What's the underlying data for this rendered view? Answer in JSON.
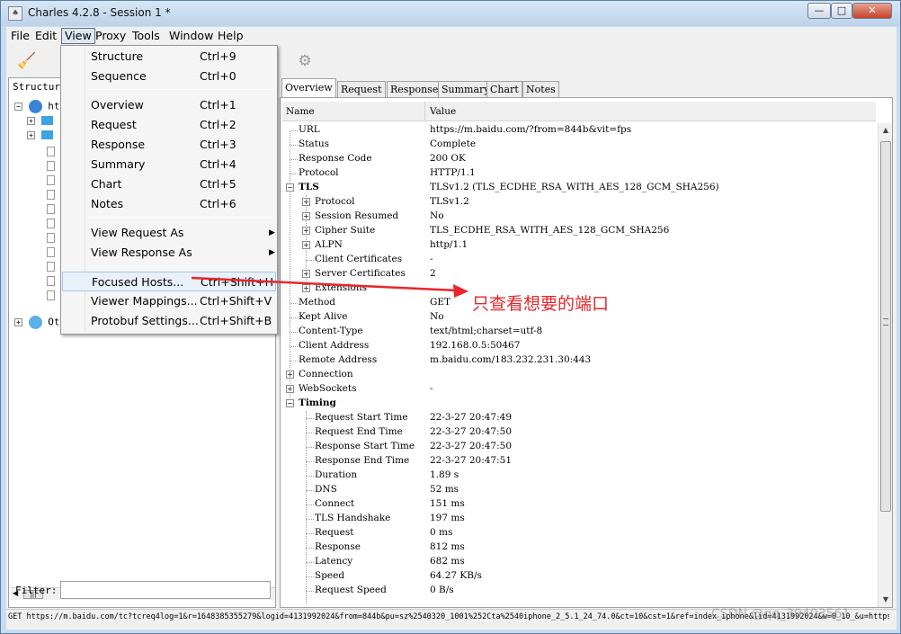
{
  "window": {
    "title": "Charles 4.2.8 - Session 1 *",
    "app_icon": "charles-icon",
    "controls": {
      "minimize": "—",
      "maximize": "□",
      "close": "✕"
    }
  },
  "menubar": {
    "items": [
      "File",
      "Edit",
      "View",
      "Proxy",
      "Tools",
      "Window",
      "Help"
    ],
    "active": "View"
  },
  "toolbar": {
    "icons": [
      "broom-icon",
      "gear-icon"
    ]
  },
  "view_menu": {
    "items": [
      {
        "label": "Structure",
        "shortcut": "Ctrl+9"
      },
      {
        "label": "Sequence",
        "shortcut": "Ctrl+0"
      },
      {
        "label": "Overview",
        "shortcut": "Ctrl+1"
      },
      {
        "label": "Request",
        "shortcut": "Ctrl+2"
      },
      {
        "label": "Response",
        "shortcut": "Ctrl+3"
      },
      {
        "label": "Summary",
        "shortcut": "Ctrl+4"
      },
      {
        "label": "Chart",
        "shortcut": "Ctrl+5"
      },
      {
        "label": "Notes",
        "shortcut": "Ctrl+6"
      },
      {
        "label": "View Request As",
        "submenu": true
      },
      {
        "label": "View Response As",
        "submenu": true
      },
      {
        "label": "Focused Hosts...",
        "shortcut": "Ctrl+Shift+H",
        "highlighted": true
      },
      {
        "label": "Viewer Mappings...",
        "shortcut": "Ctrl+Shift+V"
      },
      {
        "label": "Protobuf Settings...",
        "shortcut": "Ctrl+Shift+B"
      }
    ]
  },
  "left_panel": {
    "tab": "Structure",
    "tree": {
      "root_label": "htt",
      "other_label": "Oth"
    },
    "filter_label": "Filter:",
    "filter_value": ""
  },
  "right_panel": {
    "tabs": [
      "Overview",
      "Request",
      "Response",
      "Summary",
      "Chart",
      "Notes"
    ],
    "active_tab": "Overview",
    "columns": {
      "name": "Name",
      "value": "Value"
    },
    "rows": [
      {
        "name": "URL",
        "value": "https://m.baidu.com/?from=844b&vit=fps"
      },
      {
        "name": "Status",
        "value": "Complete"
      },
      {
        "name": "Response Code",
        "value": "200 OK"
      },
      {
        "name": "Protocol",
        "value": "HTTP/1.1"
      },
      {
        "name": "TLS",
        "value": "TLSv1.2 (TLS_ECDHE_RSA_WITH_AES_128_GCM_SHA256)"
      },
      {
        "name": "Protocol",
        "value": "TLSv1.2"
      },
      {
        "name": "Session Resumed",
        "value": "No"
      },
      {
        "name": "Cipher Suite",
        "value": "TLS_ECDHE_RSA_WITH_AES_128_GCM_SHA256"
      },
      {
        "name": "ALPN",
        "value": "http/1.1"
      },
      {
        "name": "Client Certificates",
        "value": "-"
      },
      {
        "name": "Server Certificates",
        "value": "2"
      },
      {
        "name": "Extensions",
        "value": ""
      },
      {
        "name": "Method",
        "value": "GET"
      },
      {
        "name": "Kept Alive",
        "value": "No"
      },
      {
        "name": "Content-Type",
        "value": "text/html;charset=utf-8"
      },
      {
        "name": "Client Address",
        "value": "192.168.0.5:50467"
      },
      {
        "name": "Remote Address",
        "value": "m.baidu.com/183.232.231.30:443"
      },
      {
        "name": "Connection",
        "value": ""
      },
      {
        "name": "WebSockets",
        "value": "-"
      },
      {
        "name": "Timing",
        "value": ""
      },
      {
        "name": "Request Start Time",
        "value": "22-3-27 20:47:49"
      },
      {
        "name": "Request End Time",
        "value": "22-3-27 20:47:50"
      },
      {
        "name": "Response Start Time",
        "value": "22-3-27 20:47:50"
      },
      {
        "name": "Response End Time",
        "value": "22-3-27 20:47:51"
      },
      {
        "name": "Duration",
        "value": "1.89 s"
      },
      {
        "name": "DNS",
        "value": "52 ms"
      },
      {
        "name": "Connect",
        "value": "151 ms"
      },
      {
        "name": "TLS Handshake",
        "value": "197 ms"
      },
      {
        "name": "Request",
        "value": "0 ms"
      },
      {
        "name": "Response",
        "value": "812 ms"
      },
      {
        "name": "Latency",
        "value": "682 ms"
      },
      {
        "name": "Speed",
        "value": "64.27 KB/s"
      },
      {
        "name": "Request Speed",
        "value": "0 B/s"
      }
    ]
  },
  "annotation": {
    "text": "只查看想要的端口",
    "color": "#e8262a"
  },
  "statusbar": {
    "text": "GET https://m.baidu.com/tc?tcreq4log=1&r=1648385355279&logid=4131992024&from=844b&pu=sz%2540320_1001%252Cta%2540iphone_2_5.1_24_74.0&ct=10&cst=1&ref=index_iphone&lid=4131992024&w=0_10_&u=https"
  },
  "watermark": "CSDN @qq_39403561"
}
